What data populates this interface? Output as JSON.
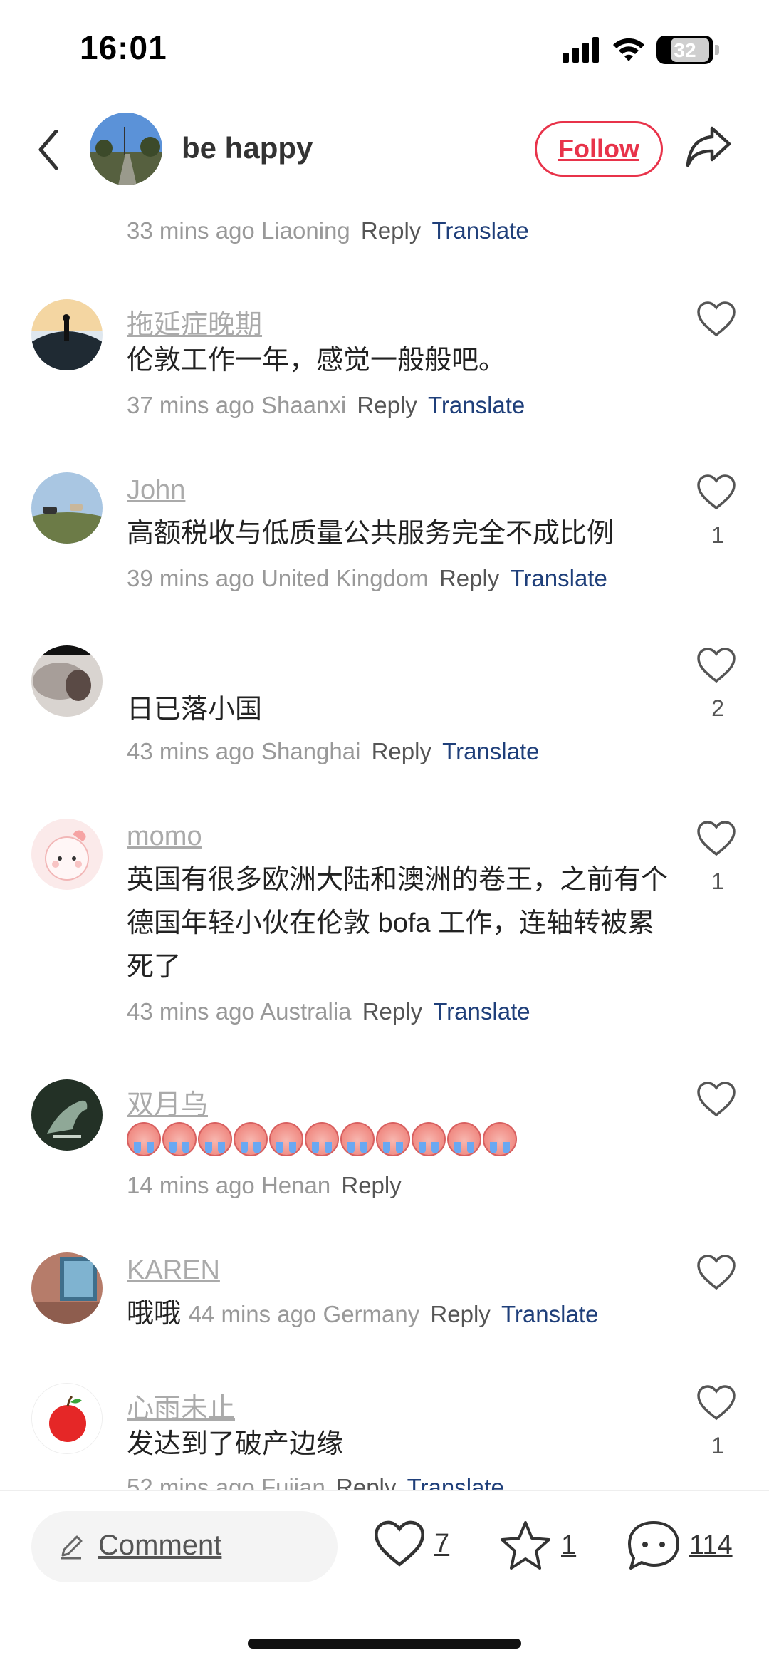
{
  "status": {
    "time": "16:01",
    "battery": "32"
  },
  "header": {
    "username": "be happy",
    "follow_label": "Follow"
  },
  "top_meta": {
    "time": "33 mins ago",
    "location": "Liaoning",
    "reply": "Reply",
    "translate": "Translate"
  },
  "comments": [
    {
      "name": "拖延症晚期",
      "text": "伦敦工作一年，感觉一般般吧。",
      "time": "37 mins ago",
      "location": "Shaanxi",
      "reply": "Reply",
      "translate": "Translate",
      "likes": ""
    },
    {
      "name": "John",
      "text": "高额税收与低质量公共服务完全不成比例",
      "time": "39 mins ago",
      "location": "United Kingdom",
      "reply": "Reply",
      "translate": "Translate",
      "likes": "1"
    },
    {
      "name": "",
      "text": "日已落小国",
      "time": "43 mins ago",
      "location": "Shanghai",
      "reply": "Reply",
      "translate": "Translate",
      "likes": "2"
    },
    {
      "name": "momo",
      "text": "英国有很多欧洲大陆和澳洲的卷王，之前有个德国年轻小伙在伦敦 bofa 工作，连轴转被累死了",
      "time": "43 mins ago",
      "location": "Australia",
      "reply": "Reply",
      "translate": "Translate",
      "likes": "1"
    },
    {
      "name": "双月乌",
      "emoji_count": 11,
      "time": "14 mins ago",
      "location": "Henan",
      "reply": "Reply",
      "likes": ""
    },
    {
      "name": "KAREN",
      "text": "哦哦",
      "time": "44 mins ago",
      "location": "Germany",
      "reply": "Reply",
      "translate": "Translate",
      "likes": ""
    },
    {
      "name": "心雨未止",
      "text": "发达到了破产边缘",
      "time": "52 mins ago",
      "location": "Fujian",
      "reply": "Reply",
      "translate": "Translate",
      "likes": "1"
    }
  ],
  "bottom_bar": {
    "comment_label": "Comment",
    "likes": "7",
    "favorites": "1",
    "comments": "114"
  },
  "colors": {
    "accent": "#e8334a",
    "translate": "#1f3f7a"
  }
}
